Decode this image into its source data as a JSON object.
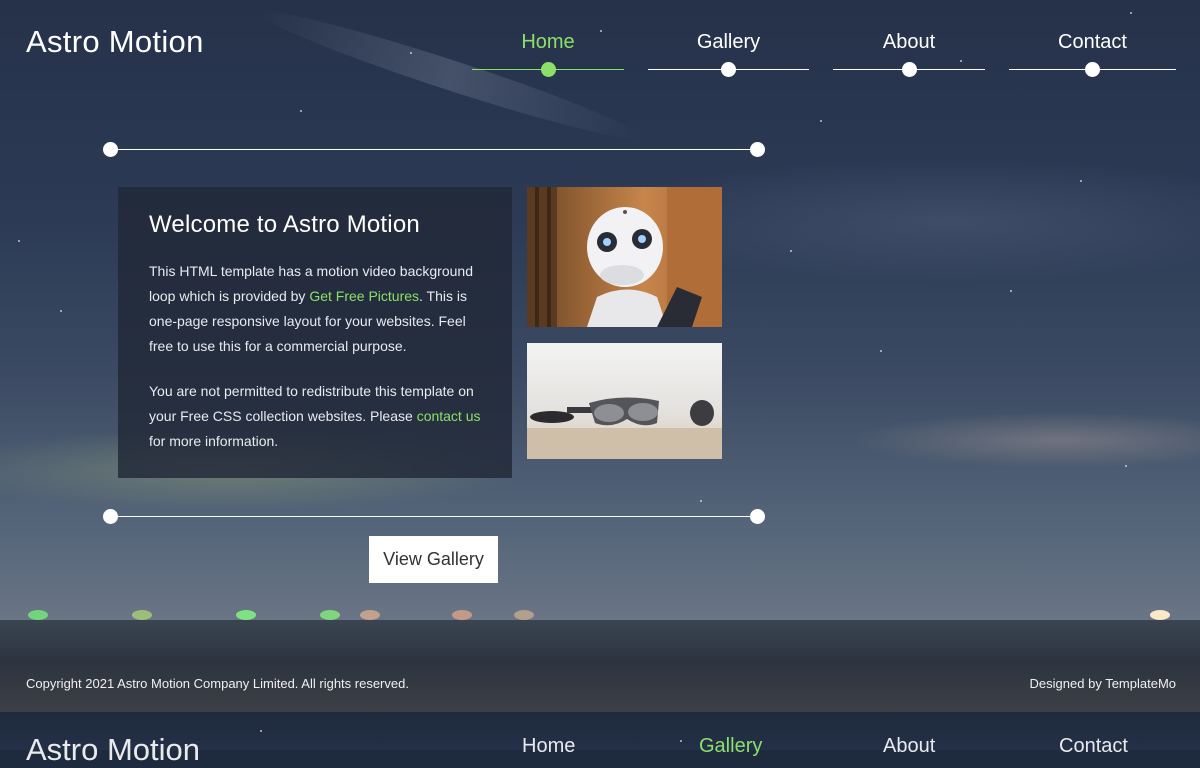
{
  "header": {
    "logo": "Astro Motion"
  },
  "nav": {
    "items": [
      {
        "label": "Home",
        "active": true
      },
      {
        "label": "Gallery",
        "active": false
      },
      {
        "label": "About",
        "active": false
      },
      {
        "label": "Contact",
        "active": false
      }
    ]
  },
  "welcome": {
    "title": "Welcome to Astro Motion",
    "p1_before": "This HTML template has a motion video background loop which is provided by ",
    "p1_link": "Get Free Pictures",
    "p1_after": ". This is one-page responsive layout for your websites. Feel free to use this for a commercial purpose.",
    "p2_before": "You are not permitted to redistribute this template on your Free CSS collection websites. Please ",
    "p2_link": "contact us",
    "p2_after": " for more information."
  },
  "button": {
    "view_gallery": "View Gallery"
  },
  "footer": {
    "copyright": "Copyright 2021 Astro Motion Company Limited. All rights reserved.",
    "designed_by": "Designed by TemplateMo"
  },
  "colors": {
    "accent": "#8ce06a",
    "panel_bg": "#212837",
    "button_bg": "#ffffff"
  },
  "icons": {
    "nav_indicator": "dot-icon",
    "rule_end": "dot-icon"
  }
}
